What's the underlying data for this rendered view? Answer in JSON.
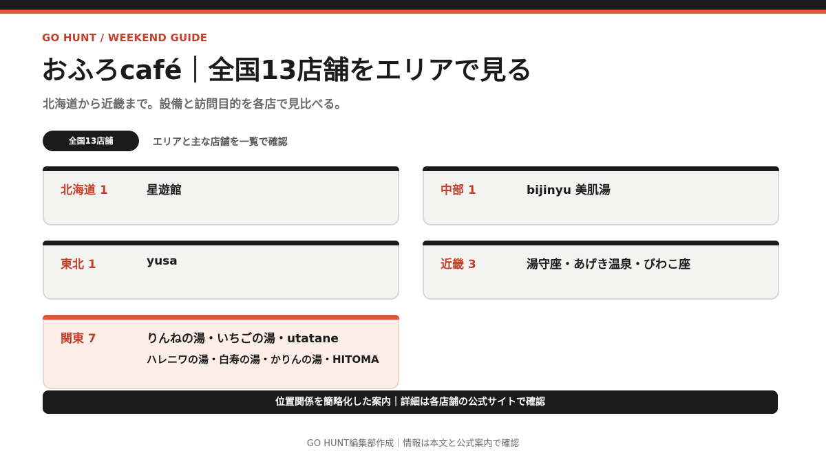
{
  "colors": {
    "accent": "#e05a37",
    "accent_text": "#c2412a",
    "dark": "#1b1b1b",
    "card_bg": "#f3f3f1",
    "highlight_bg": "#fdeee8"
  },
  "header": {
    "kicker": "GO HUNT / WEEKEND GUIDE",
    "title": "おふろcafé｜全国13店舗をエリアで見る",
    "subtitle": "北海道から近畿まで。設備と訪問目的を各店で見比べる。"
  },
  "summary": {
    "pill": "全国13店舗",
    "note": "エリアと主な店舗を一覧で確認"
  },
  "areas": [
    {
      "label": "北海道 1",
      "stores": "星遊館",
      "stores_line2": ""
    },
    {
      "label": "中部 1",
      "stores": "bijinyu 美肌湯",
      "stores_line2": ""
    },
    {
      "label": "東北 1",
      "stores": "yusa",
      "stores_line2": ""
    },
    {
      "label": "近畿 3",
      "stores": "湯守座・あげき温泉・びわこ座",
      "stores_line2": ""
    },
    {
      "label": "関東 7",
      "stores": "りんねの湯・いちごの湯・utatane",
      "stores_line2": "ハレニワの湯・白寿の湯・かりんの湯・HITOMA"
    }
  ],
  "notice": "位置関係を簡略化した案内｜詳細は各店舗の公式サイトで確認",
  "footer": "GO HUNT編集部作成｜情報は本文と公式案内で確認"
}
